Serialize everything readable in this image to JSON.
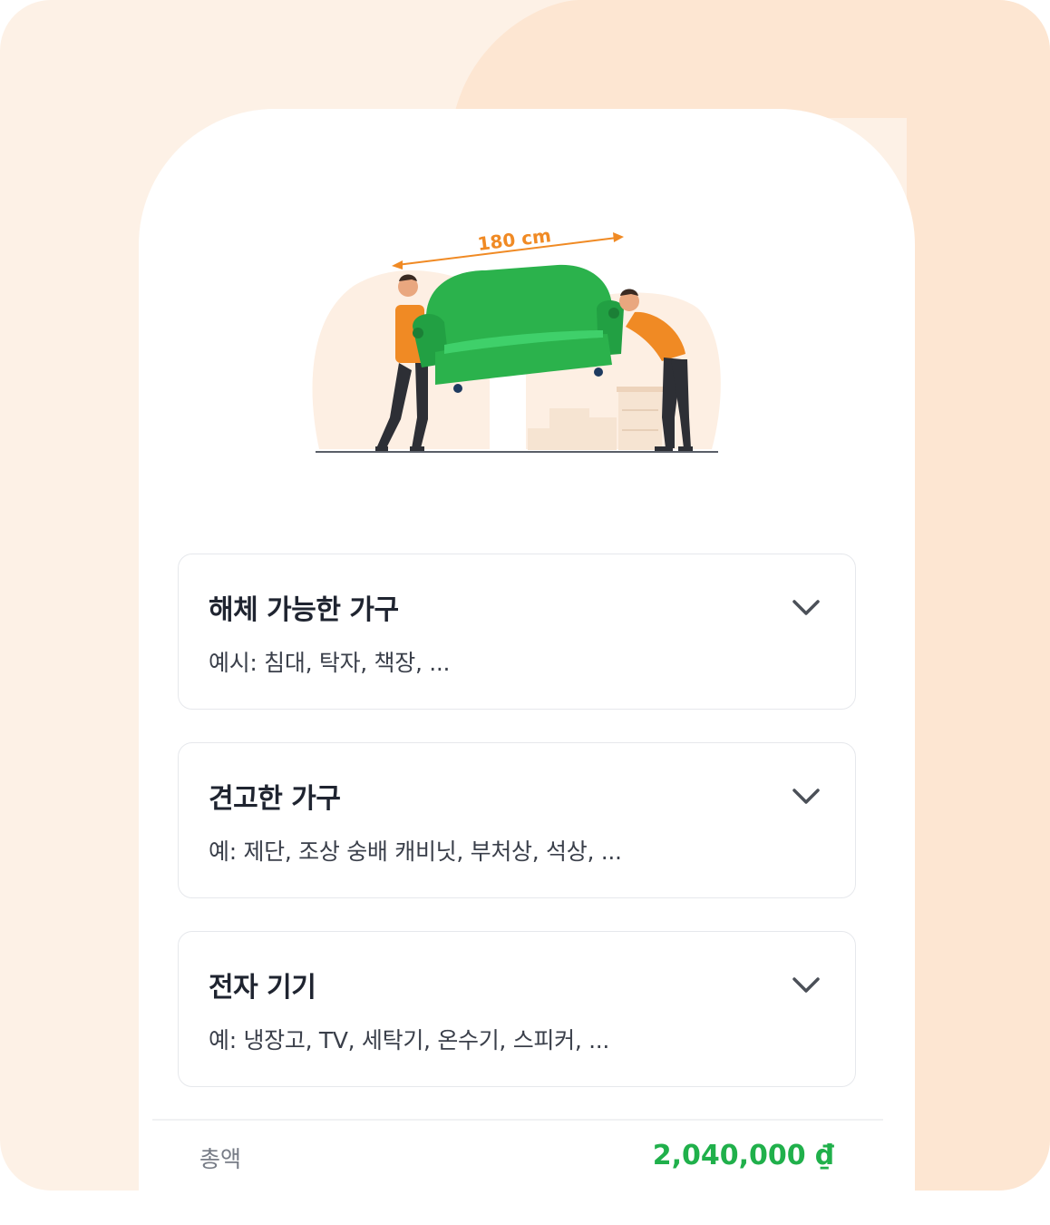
{
  "hero": {
    "dimension_label": "180 cm",
    "accent_color": "#f08a24",
    "sofa_color": "#2bb24c"
  },
  "categories": [
    {
      "title": "해체 가능한 가구",
      "description": "예시: 침대, 탁자, 책장, ..."
    },
    {
      "title": "견고한 가구",
      "description": "예: 제단, 조상 숭배 캐비닛, 부처상, 석상, ..."
    },
    {
      "title": "전자 기기",
      "description": "예: 냉장고, TV, 세탁기, 온수기, 스피커, ..."
    }
  ],
  "summary": {
    "total_label": "총액",
    "total_value": "2,040,000 ₫"
  },
  "colors": {
    "background": "#fdf1e6",
    "total_value": "#20b04b"
  }
}
